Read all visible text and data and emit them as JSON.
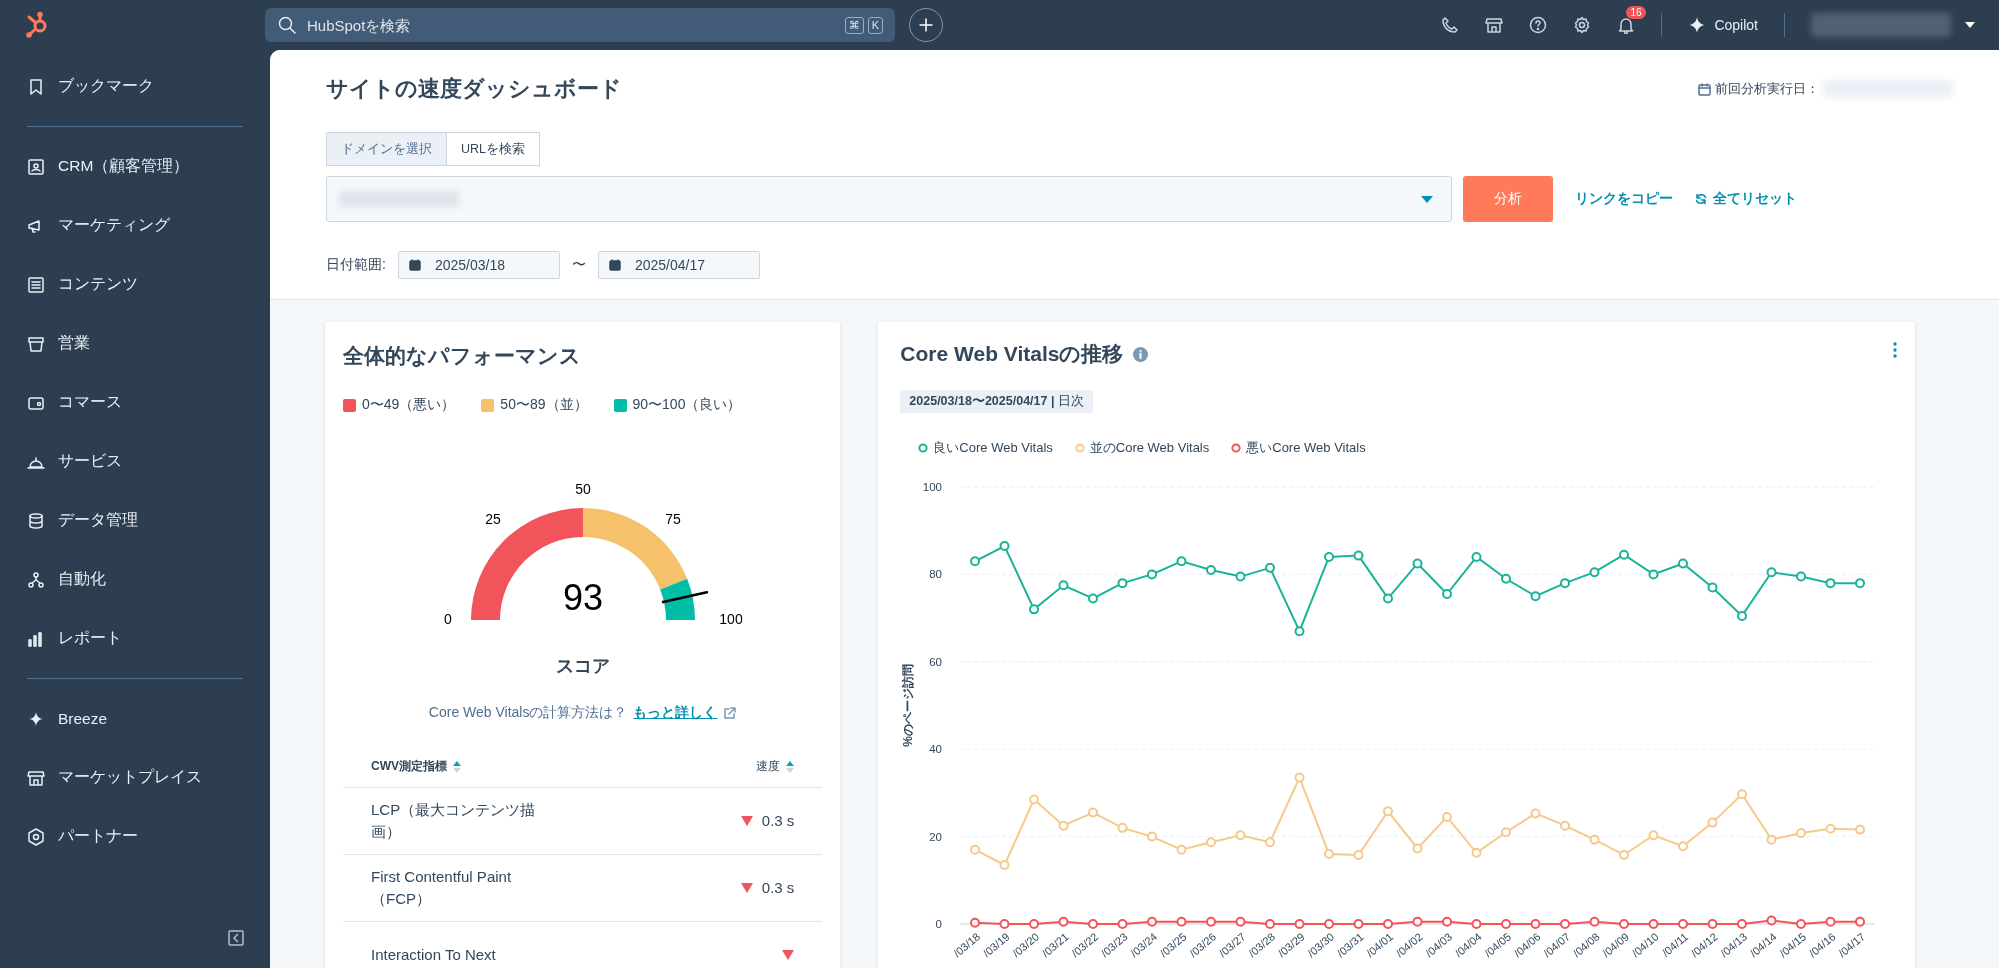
{
  "topbar": {
    "search": {
      "placeholder": "HubSpotを検索",
      "shortcut_keys": [
        "⌘",
        "K"
      ]
    },
    "notifications_badge": "16",
    "copilot_label": "Copilot"
  },
  "sidebar": {
    "sections": [
      [
        {
          "label": "ブックマーク"
        }
      ],
      [
        {
          "label": "CRM（顧客管理）"
        },
        {
          "label": "マーケティング"
        },
        {
          "label": "コンテンツ"
        },
        {
          "label": "営業"
        },
        {
          "label": "コマース"
        },
        {
          "label": "サービス"
        },
        {
          "label": "データ管理"
        },
        {
          "label": "自動化"
        },
        {
          "label": "レポート"
        }
      ],
      [
        {
          "label": "Breeze"
        },
        {
          "label": "マーケットプレイス"
        },
        {
          "label": "パートナー"
        }
      ]
    ]
  },
  "header": {
    "title": "サイトの速度ダッシュボード",
    "last_run_label": "前回分析実行日：",
    "source_tabs": [
      {
        "label": "ドメインを選択",
        "selected": true
      },
      {
        "label": "URLを検索",
        "selected": false
      }
    ],
    "analyze_button": "分析",
    "copy_link": "リンクをコピー",
    "reset_link": "全てリセット",
    "date_range": {
      "label": "日付範囲:",
      "start": "2025/03/18",
      "separator": "〜",
      "end": "2025/04/17"
    }
  },
  "performance": {
    "title": "全体的なパフォーマンス",
    "legend": [
      {
        "label": "0〜49（悪い）",
        "color": "#f2545b"
      },
      {
        "label": "50〜89（並）",
        "color": "#f5c26b"
      },
      {
        "label": "90〜100（良い）",
        "color": "#00bda5"
      }
    ],
    "gauge": {
      "score": "93",
      "ticks": [
        "0",
        "25",
        "50",
        "75",
        "100"
      ],
      "caption": "スコア"
    },
    "help_text": "Core Web Vitalsの計算方法は？",
    "help_link": "もっと詳しく",
    "table": {
      "columns": [
        "CWV測定指標",
        "速度"
      ],
      "rows": [
        {
          "metric": "LCP（最大コンテンツ描画）",
          "speed": "0.3 s",
          "decreasing": true
        },
        {
          "metric": "First Contentful Paint（FCP）",
          "speed": "0.3 s",
          "decreasing": true
        },
        {
          "metric": "Interaction To Next",
          "decreasing": true
        }
      ]
    }
  },
  "trend": {
    "title": "Core Web Vitalsの推移",
    "date_chip": "**2025/03/18〜2025/04/17 |** 日次",
    "chart_data": {
      "type": "line",
      "grid": true,
      "ylabel": "%のページ訪問",
      "ylim": [
        0,
        100
      ],
      "yticks": [
        0,
        20,
        40,
        60,
        80,
        100
      ],
      "categories": [
        "/03/18",
        "/03/19",
        "/03/20",
        "/03/21",
        "/03/22",
        "/03/23",
        "/03/24",
        "/03/25",
        "/03/26",
        "/03/27",
        "/03/28",
        "/03/29",
        "/03/30",
        "/03/31",
        "/04/01",
        "/04/02",
        "/04/03",
        "/04/04",
        "/04/05",
        "/04/06",
        "/04/07",
        "/04/08",
        "/04/09",
        "/04/10",
        "/04/11",
        "/04/12",
        "/04/13",
        "/04/14",
        "/04/15",
        "/04/16",
        "/04/17"
      ],
      "series": [
        {
          "name": "良いCore Web Vitals",
          "color": "#1bb398",
          "marker": "circle",
          "values": [
            83,
            86.5,
            72,
            77.5,
            74.5,
            78,
            80,
            83,
            81,
            79.5,
            81.5,
            67,
            84,
            84.3,
            74.5,
            82.5,
            75.5,
            84,
            79,
            75,
            78,
            80.5,
            84.5,
            80,
            82.5,
            77,
            70.5,
            80.5,
            79.5,
            78,
            78
          ]
        },
        {
          "name": "並のCore Web Vitals",
          "color": "#f5c98a",
          "marker": "circle",
          "values": [
            17,
            13.5,
            28.5,
            22.5,
            25.5,
            22,
            20,
            17,
            18.7,
            20.3,
            18.7,
            33.5,
            16,
            15.8,
            25.8,
            17.3,
            24.5,
            16.3,
            21,
            25.3,
            22.5,
            19.3,
            15.8,
            20.3,
            17.8,
            23.2,
            29.7,
            19.3,
            20.8,
            21.8,
            21.6
          ]
        },
        {
          "name": "悪いCore Web Vitals",
          "color": "#f2545b",
          "marker": "circle",
          "values": [
            0.3,
            0,
            0,
            0.5,
            0,
            0,
            0.5,
            0.5,
            0.5,
            0.5,
            0,
            0,
            0,
            0,
            0,
            0.5,
            0.5,
            0,
            0,
            0,
            0,
            0.5,
            0,
            0,
            0,
            0,
            0,
            0.8,
            0,
            0.5,
            0.5
          ]
        }
      ]
    }
  }
}
